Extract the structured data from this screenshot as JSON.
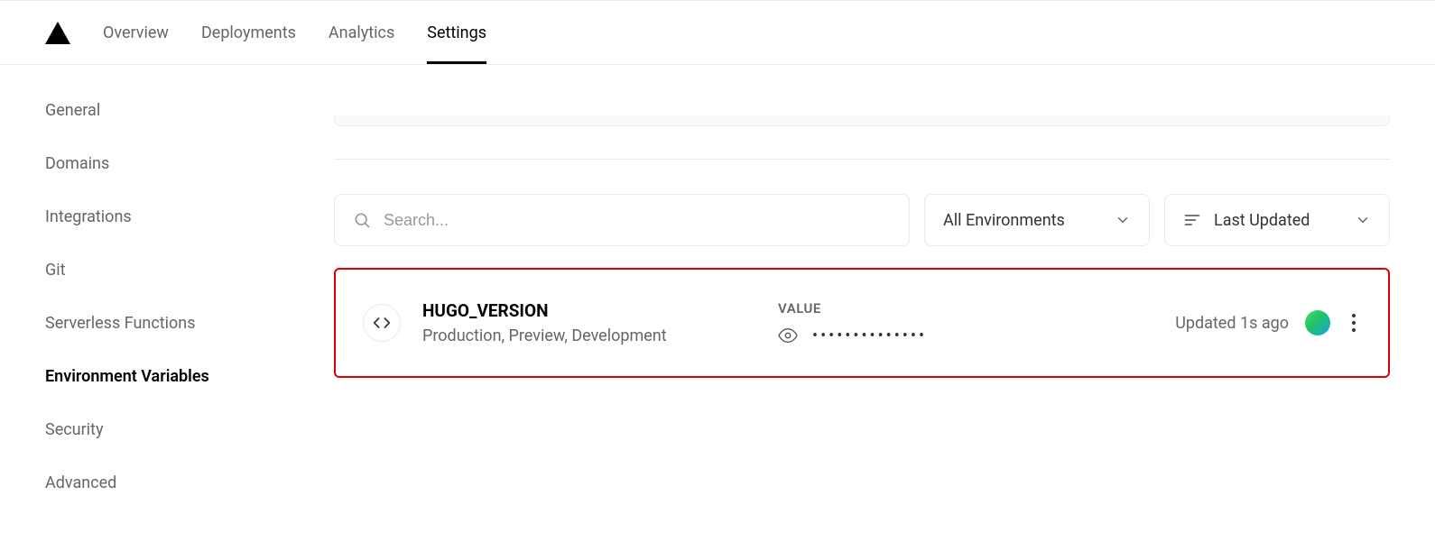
{
  "topbar": {
    "tabs": [
      {
        "label": "Overview",
        "active": false
      },
      {
        "label": "Deployments",
        "active": false
      },
      {
        "label": "Analytics",
        "active": false
      },
      {
        "label": "Settings",
        "active": true
      }
    ]
  },
  "sidebar": {
    "items": [
      {
        "label": "General",
        "active": false
      },
      {
        "label": "Domains",
        "active": false
      },
      {
        "label": "Integrations",
        "active": false
      },
      {
        "label": "Git",
        "active": false
      },
      {
        "label": "Serverless Functions",
        "active": false
      },
      {
        "label": "Environment Variables",
        "active": true
      },
      {
        "label": "Security",
        "active": false
      },
      {
        "label": "Advanced",
        "active": false
      }
    ]
  },
  "filters": {
    "search_placeholder": "Search...",
    "env_dropdown": "All Environments",
    "sort_dropdown": "Last Updated"
  },
  "env_var": {
    "name": "HUGO_VERSION",
    "environments": "Production, Preview, Development",
    "value_label": "VALUE",
    "masked_value": "••••••••••••••",
    "updated": "Updated 1s ago"
  }
}
